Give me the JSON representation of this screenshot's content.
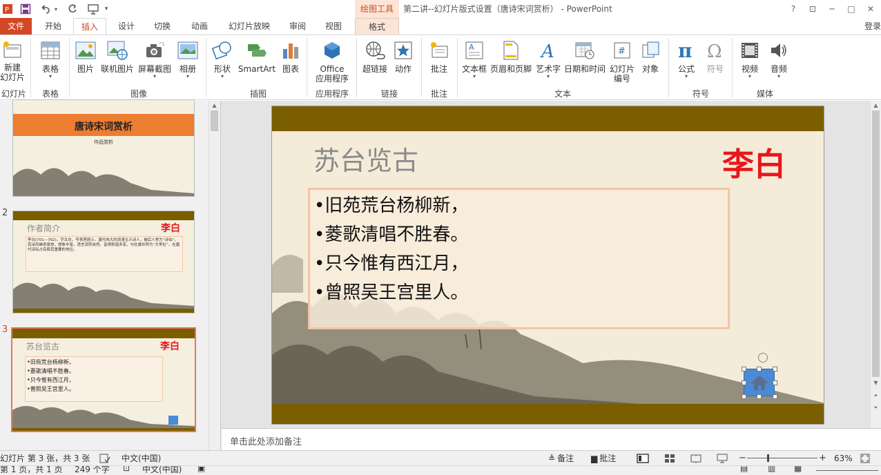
{
  "window": {
    "title": "第二讲--幻灯片版式设置（唐诗宋词赏析） - PowerPoint",
    "context_tools_label": "绘图工具",
    "login_label": "登录",
    "controls": [
      "?",
      "⊡",
      "─",
      "□",
      "✕"
    ]
  },
  "tabs": [
    {
      "label": "文件"
    },
    {
      "label": "开始"
    },
    {
      "label": "插入"
    },
    {
      "label": "设计"
    },
    {
      "label": "切换"
    },
    {
      "label": "动画"
    },
    {
      "label": "幻灯片放映"
    },
    {
      "label": "审阅"
    },
    {
      "label": "视图"
    },
    {
      "label": "格式"
    }
  ],
  "ribbon": {
    "buttons": {
      "new_slide": {
        "l1": "新建",
        "l2": "幻灯片"
      },
      "table": "表格",
      "picture": "图片",
      "online_picture": "联机图片",
      "screenshot": "屏幕截图",
      "album": "相册",
      "shapes": "形状",
      "smartart": "SmartArt",
      "chart": "图表",
      "office_apps": {
        "l1": "Office",
        "l2": "应用程序"
      },
      "hyperlink": "超链接",
      "action": "动作",
      "comment": "批注",
      "textbox": "文本框",
      "header_footer": "页眉和页脚",
      "wordart": "艺术字",
      "datetime": "日期和时间",
      "slide_number": {
        "l1": "幻灯片",
        "l2": "编号"
      },
      "object": "对象",
      "equation": "公式",
      "symbol": "符号",
      "video": "视频",
      "audio": "音频"
    },
    "groups": {
      "slides": "幻灯片",
      "tables": "表格",
      "images": "图像",
      "illustrations": "插图",
      "apps": "应用程序",
      "links": "链接",
      "comments": "批注",
      "text": "文本",
      "symbols": "符号",
      "media": "媒体"
    }
  },
  "thumbnails": [
    {
      "number": "",
      "title": "唐诗宋词赏析",
      "subtitle": "作品赏析"
    },
    {
      "number": "2",
      "title": "作者简介",
      "author": "李白",
      "body": "李白(701—762)，字太白，号青莲居士，唐代伟大的浪漫主义诗人，被后人誉为“诗仙”。其诗风雄奇豪放，想象丰富，语言流转自然，音律和谐多变。与杜甫并称为“大李杜”，在唐代诗坛占有极其重要的地位。"
    },
    {
      "number": "3",
      "title": "苏台览古",
      "author": "李白",
      "lines": [
        "•旧苑荒台杨柳新，",
        "•菱歌清唱不胜春。",
        "•只今惟有西江月，",
        "•曾照吴王宫里人。"
      ]
    }
  ],
  "slide": {
    "title": "苏台览古",
    "author": "李白",
    "lines": [
      "•旧苑荒台杨柳新，",
      "•菱歌清唱不胜春。",
      "•只今惟有西江月，",
      "•曾照吴王宫里人。"
    ]
  },
  "notes_placeholder": "单击此处添加备注",
  "status": {
    "slide_info": "幻灯片 第 3 张，共 3 张",
    "language": "中文(中国)",
    "notes_btn": "备注",
    "comments_btn": "批注",
    "zoom": "63%",
    "zoom_level": 0.63
  },
  "status2": {
    "page_info": "第 1 页，共 1 页",
    "word_count": "249 个字",
    "language": "中文(中国)"
  },
  "colors": {
    "accent": "#d24726",
    "band": "#7a5e00",
    "author_red": "#e8161b",
    "box_border": "#f6c3a6",
    "home_button": "#4a8ad6"
  }
}
